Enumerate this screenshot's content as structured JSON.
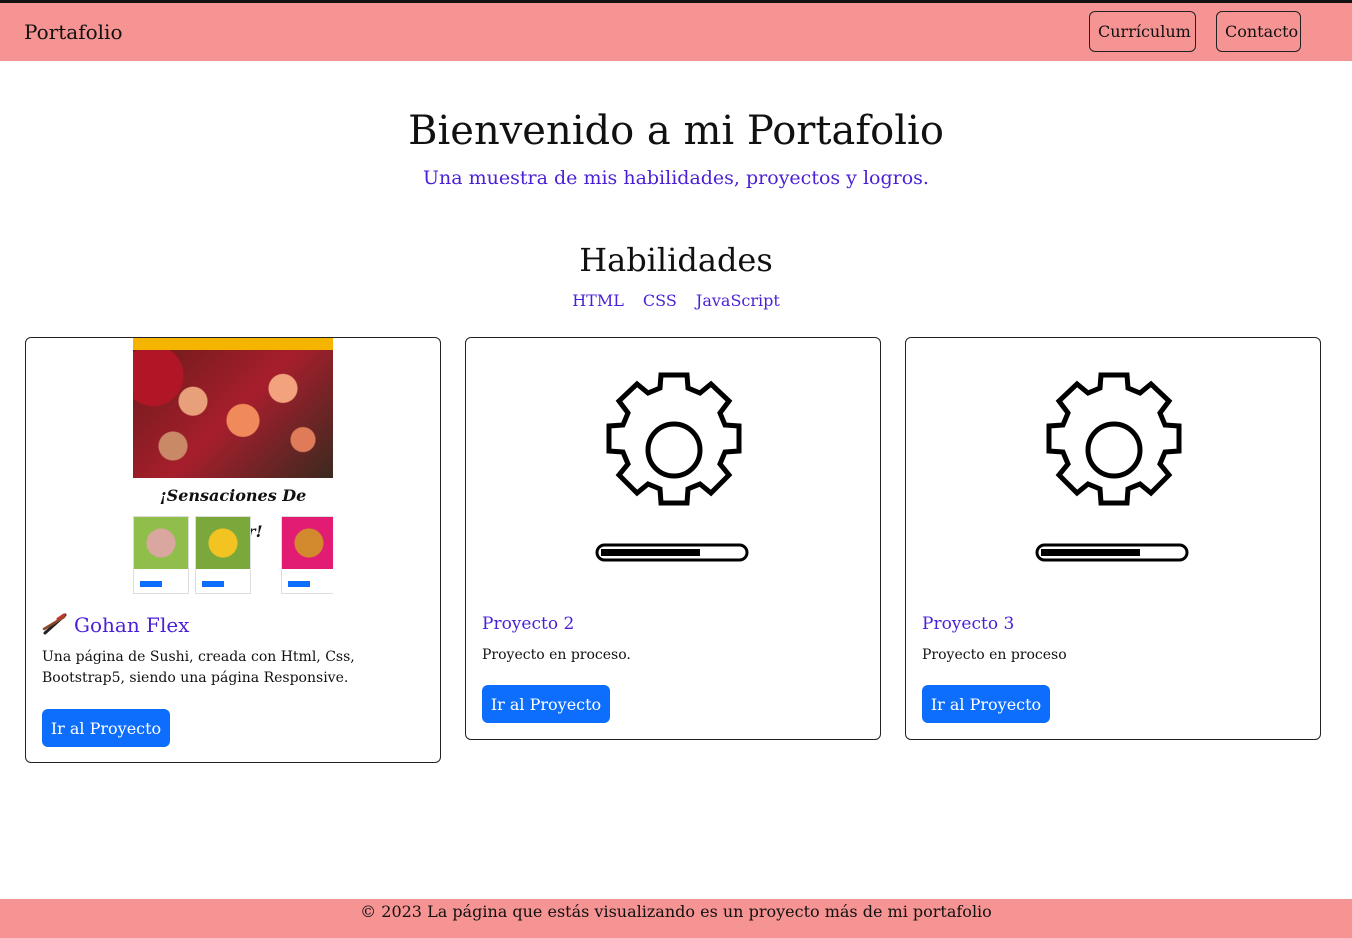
{
  "nav": {
    "brand": "Portafolio",
    "buttons": [
      "Currículum",
      "Contacto"
    ]
  },
  "hero": {
    "title": "Bienvenido a mi Portafolio",
    "subtitle": "Una muestra de mis habilidades, proyectos y logros."
  },
  "skills": {
    "title": "Habilidades",
    "items": [
      "HTML",
      "CSS",
      "JavaScript"
    ]
  },
  "projects": [
    {
      "title": "Gohan Flex",
      "icon": "chopsticks-icon",
      "thumbnail_text": "¡Sensaciones De Sabor!",
      "description": "Una página de Sushi, creada con Html, Css, Bootstrap5, siendo una página Responsive.",
      "button": "Ir al Proyecto"
    },
    {
      "title": "Proyecto 2",
      "icon": "gear-loading-icon",
      "progress": 0.7,
      "description": "Proyecto en proceso.",
      "button": "Ir al Proyecto"
    },
    {
      "title": "Proyecto 3",
      "icon": "gear-loading-icon",
      "progress": 0.7,
      "description": "Proyecto en proceso",
      "button": "Ir al Proyecto"
    }
  ],
  "footer": {
    "text": "© 2023 La página que estás visualizando es un proyecto más de mi portafolio"
  },
  "colors": {
    "navbar": "#f69393",
    "accent_text": "#4a1fd6",
    "button": "#0d6efd"
  }
}
